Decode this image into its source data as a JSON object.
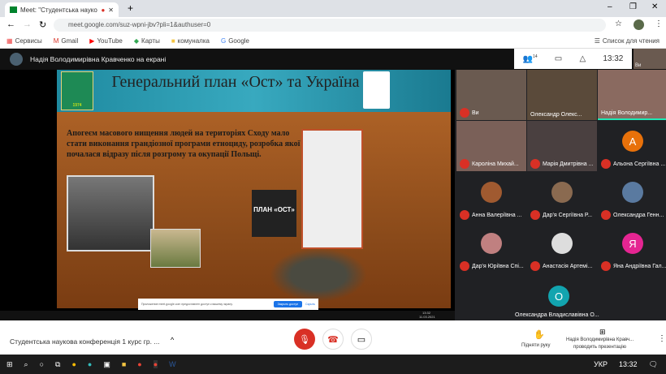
{
  "browser": {
    "tab_title": "Meet: \"Студентська науков",
    "url": "meet.google.com/suz-wpni-jbv?pli=1&authuser=0",
    "bookmarks": [
      "Сервисы",
      "Gmail",
      "YouTube",
      "Карты",
      "комуналка",
      "Google"
    ],
    "reading_list": "Список для чтения"
  },
  "meet": {
    "presenter_banner": "Надія Володимирівна Кравченко на екрані",
    "participants_count": "14",
    "time": "13:32",
    "self_label": "Ви",
    "participants": [
      {
        "name": "Ви",
        "color": "#6a5a50"
      },
      {
        "name": "Олександр Олекс...",
        "color": "#5a4a3a"
      },
      {
        "name": "Надія Володимир...",
        "color": "#8a6a60"
      },
      {
        "name": "Кароліна Михай...",
        "color": "#7a6058"
      },
      {
        "name": "Марія Дмитрівна ...",
        "color": "#4a4040"
      },
      {
        "name": "Альона Сергіївна ...",
        "initial": "А",
        "color": "#e8710a"
      },
      {
        "name": "Анна Валеріївна ...",
        "color": "#a05a30"
      },
      {
        "name": "Дар'я Сергіївна Р...",
        "color": "#8a6a50"
      },
      {
        "name": "Олександра Генн...",
        "color": "#5a7aa0"
      },
      {
        "name": "Дар'я Юріївна Спі...",
        "color": "#c08080"
      },
      {
        "name": "Анастасія Артемі...",
        "color": "#ddd"
      },
      {
        "name": "Яна Андріївна Гал...",
        "initial": "Я",
        "color": "#e52592"
      },
      {
        "name": "Олександра Владиславівна О...",
        "initial": "О",
        "color": "#12a4af"
      }
    ],
    "meeting_title": "Студентська наукова конференція 1 курс гр. ...",
    "raise_hand": "Підняти руку",
    "presenting_name": "Надія Володимирівна Кравч...",
    "presenting_label": "проводить презентацію"
  },
  "slide": {
    "title": "Генеральний план «Ост» та Україна",
    "text": "Апогеєм масового нищення людей на територіях Сходу мало стати виконання грандіозної програми етноциду, розробка якої почалася відразу після розгрому та окупації Польщі.",
    "book_title": "ПЛАН «ОСТ»",
    "logo_year": "1974"
  },
  "share_banner": {
    "text": "Приложение meet.google.com предоставлен доступ к вашему экрану.",
    "stop": "Закрыть доступ",
    "hide": "Скрыть"
  },
  "inner_taskbar": {
    "time": "13:32",
    "date": "11.03.2021"
  },
  "taskbar": {
    "lang": "УКР",
    "time": "13:32"
  }
}
